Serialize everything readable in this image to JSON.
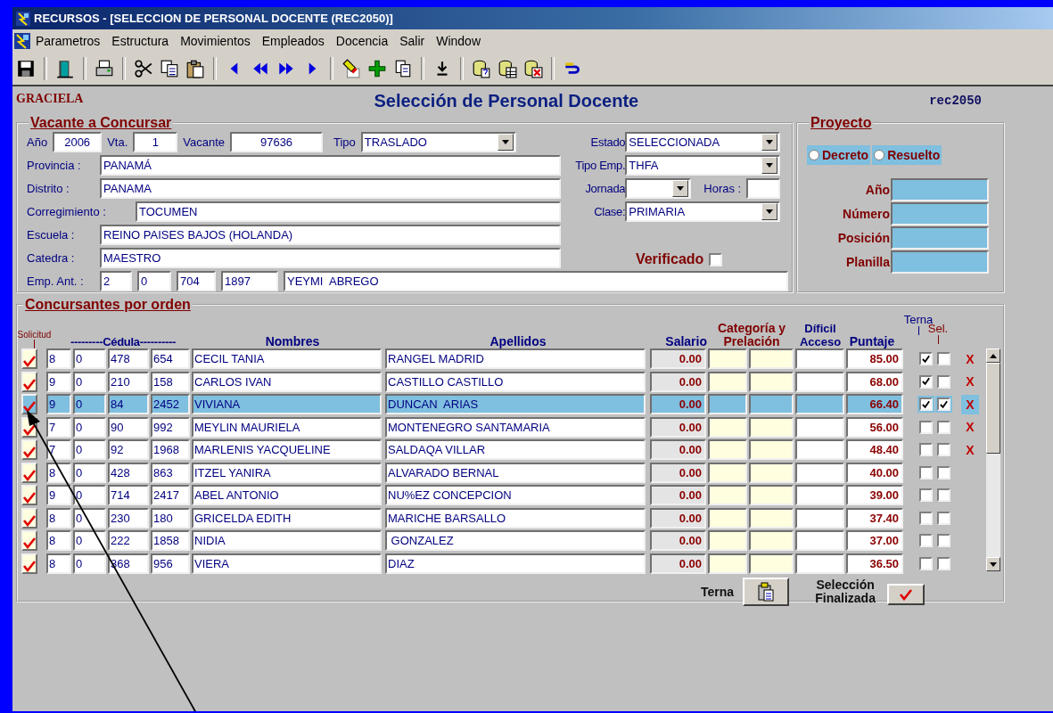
{
  "window": {
    "title": "RECURSOS - [SELECCION DE PERSONAL DOCENTE (REC2050)]"
  },
  "menu": [
    "Parametros",
    "Estructura",
    "Movimientos",
    "Empleados",
    "Docencia",
    "Salir",
    "Window"
  ],
  "header": {
    "user": "GRACIELA",
    "title": "Selección de Personal Docente",
    "form_code": "rec2050"
  },
  "vacante": {
    "legend": "Vacante a Concursar",
    "ano": {
      "label": "Año",
      "value": "2006"
    },
    "vta": {
      "label": "Vta.",
      "value": "1"
    },
    "vacante": {
      "label": "Vacante",
      "value": "97636"
    },
    "tipo": {
      "label": "Tipo",
      "value": "TRASLADO"
    },
    "provincia": {
      "label": "Provincia :",
      "value": "PANAMÁ"
    },
    "distrito": {
      "label": "Distrito :",
      "value": "PANAMA"
    },
    "corregimiento": {
      "label": "Corregimiento :",
      "value": "TOCUMEN"
    },
    "escuela": {
      "label": "Escuela :",
      "value": "REINO PAISES BAJOS (HOLANDA)"
    },
    "catedra": {
      "label": "Catedra :",
      "value": "MAESTRO"
    },
    "emp_ant": {
      "label": "Emp. Ant. :",
      "values": [
        "2",
        "0",
        "704",
        "1897",
        "YEYMI  ABREGO"
      ]
    },
    "estado": {
      "label": "Estado",
      "value": "SELECCIONADA"
    },
    "tipo_emp": {
      "label": "Tipo Emp.",
      "value": "THFA"
    },
    "jornada": {
      "label": "Jornada"
    },
    "horas": {
      "label": "Horas :"
    },
    "clase": {
      "label": "Clase:",
      "value": "PRIMARIA"
    },
    "verificado": {
      "label": "Verificado",
      "checked": false
    }
  },
  "proyecto": {
    "legend": "Proyecto",
    "options": [
      {
        "label": "Decreto",
        "selected": false
      },
      {
        "label": "Resuelto",
        "selected": false
      }
    ],
    "fields": [
      {
        "label": "Año"
      },
      {
        "label": "Número"
      },
      {
        "label": "Posición"
      },
      {
        "label": "Planilla"
      }
    ]
  },
  "concursantes": {
    "legend": "Concursantes por orden",
    "columns": {
      "solicitud": "Solicitud",
      "cedula": "---------Cédula----------",
      "nombres": "Nombres",
      "apellidos": "Apellidos",
      "salario": "Salario",
      "categoria": "Categoría y Prelación",
      "acceso": "Díficil Acceso",
      "puntaje": "Puntaje",
      "terna": "Terna",
      "sel": "Sel."
    },
    "rows": [
      {
        "solicitud": true,
        "cedula": [
          "8",
          "0",
          "478",
          "654"
        ],
        "nombres": "CECIL TANIA",
        "apellidos": "RANGEL MADRID",
        "salario": "0.00",
        "puntaje": "85.00",
        "terna": true,
        "sel": false,
        "remove": "X",
        "selected": false
      },
      {
        "solicitud": true,
        "cedula": [
          "9",
          "0",
          "210",
          "158"
        ],
        "nombres": "CARLOS IVAN",
        "apellidos": "CASTILLO CASTILLO",
        "salario": "0.00",
        "puntaje": "68.00",
        "terna": true,
        "sel": false,
        "remove": "X",
        "selected": false
      },
      {
        "solicitud": true,
        "cedula": [
          "9",
          "0",
          "84",
          "2452"
        ],
        "nombres": "VIVIANA",
        "apellidos": "DUNCAN  ARIAS",
        "salario": "0.00",
        "puntaje": "66.40",
        "terna": true,
        "sel": true,
        "remove": "X",
        "selected": true
      },
      {
        "solicitud": true,
        "cedula": [
          "7",
          "0",
          "90",
          "992"
        ],
        "nombres": "MEYLIN MAURIELA",
        "apellidos": "MONTENEGRO SANTAMARIA",
        "salario": "0.00",
        "puntaje": "56.00",
        "terna": false,
        "sel": false,
        "remove": "X",
        "selected": false
      },
      {
        "solicitud": true,
        "cedula": [
          "7",
          "0",
          "92",
          "1968"
        ],
        "nombres": "MARLENIS YACQUELINE",
        "apellidos": "SALDAQA VILLAR",
        "salario": "0.00",
        "puntaje": "48.40",
        "terna": false,
        "sel": false,
        "remove": "X",
        "selected": false
      },
      {
        "solicitud": true,
        "cedula": [
          "8",
          "0",
          "428",
          "863"
        ],
        "nombres": "ITZEL YANIRA",
        "apellidos": "ALVARADO BERNAL",
        "salario": "0.00",
        "puntaje": "40.00",
        "terna": false,
        "sel": false,
        "selected": false
      },
      {
        "solicitud": true,
        "cedula": [
          "9",
          "0",
          "714",
          "2417"
        ],
        "nombres": "ABEL ANTONIO",
        "apellidos": "NU%EZ CONCEPCION",
        "salario": "0.00",
        "puntaje": "39.00",
        "terna": false,
        "sel": false,
        "selected": false
      },
      {
        "solicitud": true,
        "cedula": [
          "8",
          "0",
          "230",
          "180"
        ],
        "nombres": "GRICELDA EDITH",
        "apellidos": "MARICHE BARSALLO",
        "salario": "0.00",
        "puntaje": "37.40",
        "terna": false,
        "sel": false,
        "selected": false
      },
      {
        "solicitud": true,
        "cedula": [
          "8",
          "0",
          "222",
          "1858"
        ],
        "nombres": "NIDIA",
        "apellidos": " GONZALEZ",
        "salario": "0.00",
        "puntaje": "37.00",
        "terna": false,
        "sel": false,
        "selected": false
      },
      {
        "solicitud": true,
        "cedula": [
          "8",
          "0",
          "368",
          "956"
        ],
        "nombres": "VIERA",
        "apellidos": "DIAZ",
        "salario": "0.00",
        "puntaje": "36.50",
        "terna": false,
        "sel": false,
        "selected": false
      }
    ],
    "terna_button": {
      "label": "Terna"
    },
    "finalize_button": {
      "label": "Selección Finalizada"
    }
  }
}
